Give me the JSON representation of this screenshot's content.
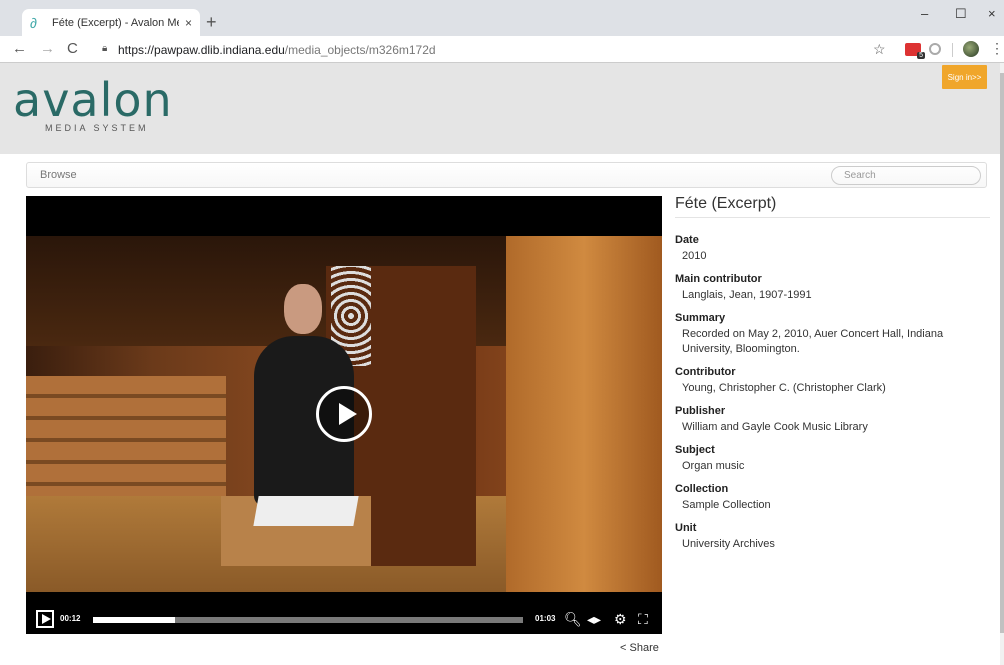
{
  "browser": {
    "tab_title": "Féte (Excerpt) - Avalon Media Sys",
    "tab_close": "×",
    "new_tab": "+",
    "url_host": "https://pawpaw.dlib.indiana.edu",
    "url_path": "/media_objects/m326m172d",
    "ext_badge": "5",
    "window_min": "–",
    "window_max": "☐",
    "window_close": "×"
  },
  "header": {
    "logo_word": "avalon",
    "logo_sub": "MEDIA SYSTEM",
    "signin_label": "Sign in>>"
  },
  "nav": {
    "browse_label": "Browse",
    "search_placeholder": "Search"
  },
  "player": {
    "current_time": "00:12",
    "duration": "01:03",
    "progress_fraction": 0.19
  },
  "share_label": "Share",
  "item": {
    "title": "Féte (Excerpt)",
    "fields": [
      {
        "label": "Date",
        "value": "2010"
      },
      {
        "label": "Main contributor",
        "value": "Langlais, Jean, 1907-1991"
      },
      {
        "label": "Summary",
        "value": "Recorded on May 2, 2010, Auer Concert Hall, Indiana University, Bloomington."
      },
      {
        "label": "Contributor",
        "value": "Young, Christopher C. (Christopher Clark)"
      },
      {
        "label": "Publisher",
        "value": "William and Gayle Cook Music Library"
      },
      {
        "label": "Subject",
        "value": "Organ music"
      },
      {
        "label": "Collection",
        "value": "Sample Collection"
      },
      {
        "label": "Unit",
        "value": "University Archives"
      }
    ]
  }
}
